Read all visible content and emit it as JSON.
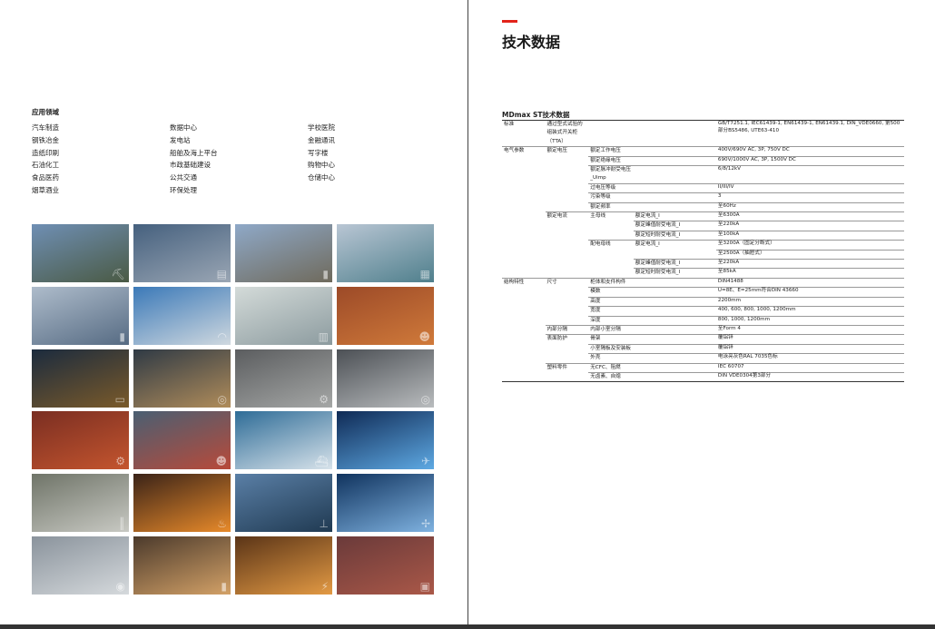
{
  "applications": {
    "title": "应用领域",
    "items": [
      "汽车制造",
      "数据中心",
      "学校医院",
      "钢铁冶金",
      "发电站",
      "金融通讯",
      "造纸印刷",
      "船舶及海上平台",
      "写字楼",
      "石油化工",
      "市政基础建设",
      "购物中心",
      "食品医药",
      "公共交通",
      "仓储中心",
      "烟草酒业",
      "环保处理"
    ]
  },
  "photos": [
    {
      "name": "construction-cranes-photo",
      "icon": "crane",
      "colors": [
        "#6f8fb4",
        "#4a5a44"
      ]
    },
    {
      "name": "city-skyline-photo",
      "icon": "city",
      "colors": [
        "#45607e",
        "#9aa6b4"
      ]
    },
    {
      "name": "office-towers-photo",
      "icon": "tower",
      "colors": [
        "#8fa9c8",
        "#6f6a5c"
      ]
    },
    {
      "name": "waterfront-building-photo",
      "icon": "building",
      "colors": [
        "#b9c6d4",
        "#4f7f8c"
      ]
    },
    {
      "name": "skyscrapers-photo",
      "icon": "tower",
      "colors": [
        "#aebccb",
        "#566b83"
      ]
    },
    {
      "name": "stadium-roof-photo",
      "icon": "stadium",
      "colors": [
        "#3b79b8",
        "#cfd8df"
      ]
    },
    {
      "name": "server-room-photo",
      "icon": "server",
      "colors": [
        "#d4dbd9",
        "#8c9b9f"
      ]
    },
    {
      "name": "technician-cabinet-photo",
      "icon": "worker",
      "colors": [
        "#9c4a28",
        "#d07a3a"
      ]
    },
    {
      "name": "control-room-photo",
      "icon": "monitor",
      "colors": [
        "#1b2b3e",
        "#7a5a2a"
      ]
    },
    {
      "name": "paper-mill-photo",
      "icon": "roll",
      "colors": [
        "#2f3a45",
        "#b08c5a"
      ]
    },
    {
      "name": "factory-machinery-photo",
      "icon": "gear",
      "colors": [
        "#5b5d5f",
        "#a5a7a6"
      ]
    },
    {
      "name": "steel-roller-photo",
      "icon": "roll",
      "colors": [
        "#4c5055",
        "#b9bcbe"
      ]
    },
    {
      "name": "robot-assembly-photo",
      "icon": "robot",
      "colors": [
        "#7a2e22",
        "#c4552e"
      ]
    },
    {
      "name": "factory-workers-photo",
      "icon": "worker",
      "colors": [
        "#4a5f72",
        "#b84a3a"
      ]
    },
    {
      "name": "cruise-ship-photo",
      "icon": "ship",
      "colors": [
        "#2e6c97",
        "#d7e2ea"
      ]
    },
    {
      "name": "airport-runway-lights-photo",
      "icon": "plane",
      "colors": [
        "#0f2a55",
        "#5ea9e3"
      ]
    },
    {
      "name": "refinery-pipes-photo",
      "icon": "pipe",
      "colors": [
        "#6f7468",
        "#c8c9c3"
      ]
    },
    {
      "name": "steel-furnace-photo",
      "icon": "fire",
      "colors": [
        "#3a2318",
        "#e88a2a"
      ]
    },
    {
      "name": "offshore-platform-photo",
      "icon": "platform",
      "colors": [
        "#5a7fa6",
        "#203a52"
      ]
    },
    {
      "name": "wind-turbines-photo",
      "icon": "wind",
      "colors": [
        "#10335e",
        "#7fb2e0"
      ]
    },
    {
      "name": "steel-wire-coils-photo",
      "icon": "coil",
      "colors": [
        "#8a939c",
        "#d5d9dc"
      ]
    },
    {
      "name": "smokestacks-photo",
      "icon": "chimney",
      "colors": [
        "#4b3a2c",
        "#d3a167"
      ]
    },
    {
      "name": "power-transmission-tower-photo",
      "icon": "pylon",
      "colors": [
        "#5a3417",
        "#e39a44"
      ]
    },
    {
      "name": "container-port-photo",
      "icon": "container",
      "colors": [
        "#6a3a3a",
        "#aa5848"
      ]
    }
  ],
  "spec": {
    "heading": "技术数据",
    "table_title": "MDmax ST技术数据",
    "rows": [
      {
        "c1": "标准",
        "c2": "通过型式试验的组装式开关柜（TTA）",
        "c3": "",
        "c4": "",
        "c5": "GB/T7251.1, IEC61439-1, EN61439-1, EN61439.1, DIN_VDE0660, 第500部分BS5486, UTE63-410",
        "sep": true,
        "tall": true
      },
      {
        "c1": "电气参数",
        "c2": "额定电压",
        "c3": "额定工作电压",
        "c4": "",
        "c5": "400V/690V AC, 3P, 750V DC",
        "sep": true
      },
      {
        "c1": "",
        "c2": "",
        "c3": "额定绝缘电压",
        "c4": "",
        "c5": "690V/1000V AC, 3P, 1500V DC",
        "sep": true
      },
      {
        "c1": "",
        "c2": "",
        "c3": "额定脉冲耐受电压_Uimp",
        "c4": "",
        "c5": "6/8/12kV",
        "sep": true
      },
      {
        "c1": "",
        "c2": "",
        "c3": "过电压等级",
        "c4": "",
        "c5": "II/III/IV",
        "sep": true
      },
      {
        "c1": "",
        "c2": "",
        "c3": "污染等级",
        "c4": "",
        "c5": "3",
        "sep": true
      },
      {
        "c1": "",
        "c2": "",
        "c3": "额定频率",
        "c4": "",
        "c5": "至60Hz",
        "sep": true
      },
      {
        "c1": "",
        "c2": "额定电流",
        "c3": "主母线",
        "c4": "额定电流_I",
        "c5": "至6300A",
        "sep": true
      },
      {
        "c1": "",
        "c2": "",
        "c3": "",
        "c4": "额定峰值耐受电流_I",
        "c5": "至220kA",
        "sep": true
      },
      {
        "c1": "",
        "c2": "",
        "c3": "",
        "c4": "额定短时耐受电流_I",
        "c5": "至100kA",
        "sep": true
      },
      {
        "c1": "",
        "c2": "",
        "c3": "配电母线",
        "c4": "额定电流_I",
        "c5": "至3200A（固定分断式）",
        "sep": true
      },
      {
        "c1": "",
        "c2": "",
        "c3": "",
        "c4": "",
        "c5": "至2500A（抽屉式）",
        "sep": true
      },
      {
        "c1": "",
        "c2": "",
        "c3": "",
        "c4": "额定峰值耐受电流_I",
        "c5": "至220kA",
        "sep": true
      },
      {
        "c1": "",
        "c2": "",
        "c3": "",
        "c4": "额定短时耐受电流_I",
        "c5": "至85kA",
        "sep": true
      },
      {
        "c1": "结构特性",
        "c2": "尺寸",
        "c3": "柜体和支件构件",
        "c4": "",
        "c5": "DIN41488",
        "sep": true
      },
      {
        "c1": "",
        "c2": "",
        "c3": "模数",
        "c4": "",
        "c5": "U=8E、E=25mm符合DIN 43660",
        "sep": true
      },
      {
        "c1": "",
        "c2": "",
        "c3": "高度",
        "c4": "",
        "c5": "2200mm",
        "sep": true
      },
      {
        "c1": "",
        "c2": "",
        "c3": "宽度",
        "c4": "",
        "c5": "400, 600, 800, 1000, 1200mm",
        "sep": true
      },
      {
        "c1": "",
        "c2": "",
        "c3": "深度",
        "c4": "",
        "c5": "800, 1000, 1200mm",
        "sep": true
      },
      {
        "c1": "",
        "c2": "内部分隔",
        "c3": "内部小室分隔",
        "c4": "",
        "c5": "至Form 4",
        "sep": true
      },
      {
        "c1": "",
        "c2": "表面防护",
        "c3": "骨架",
        "c4": "",
        "c5": "覆铝锌",
        "sep": true
      },
      {
        "c1": "",
        "c2": "",
        "c3": "小室隔板及安装板",
        "c4": "",
        "c5": "覆铝锌",
        "sep": true
      },
      {
        "c1": "",
        "c2": "",
        "c3": "外壳",
        "c4": "",
        "c5": "电泳亮灰色RAL 7035色标",
        "sep": true
      },
      {
        "c1": "",
        "c2": "塑料零件",
        "c3": "无CFC、阻燃",
        "c4": "",
        "c5": "IEC 60707",
        "sep": true
      },
      {
        "c1": "",
        "c2": "",
        "c3": "无卤素、自熄",
        "c4": "",
        "c5": "DIN VDE0304第3部分",
        "sep": true
      }
    ]
  },
  "colors": {
    "accent": "#e2231a"
  }
}
